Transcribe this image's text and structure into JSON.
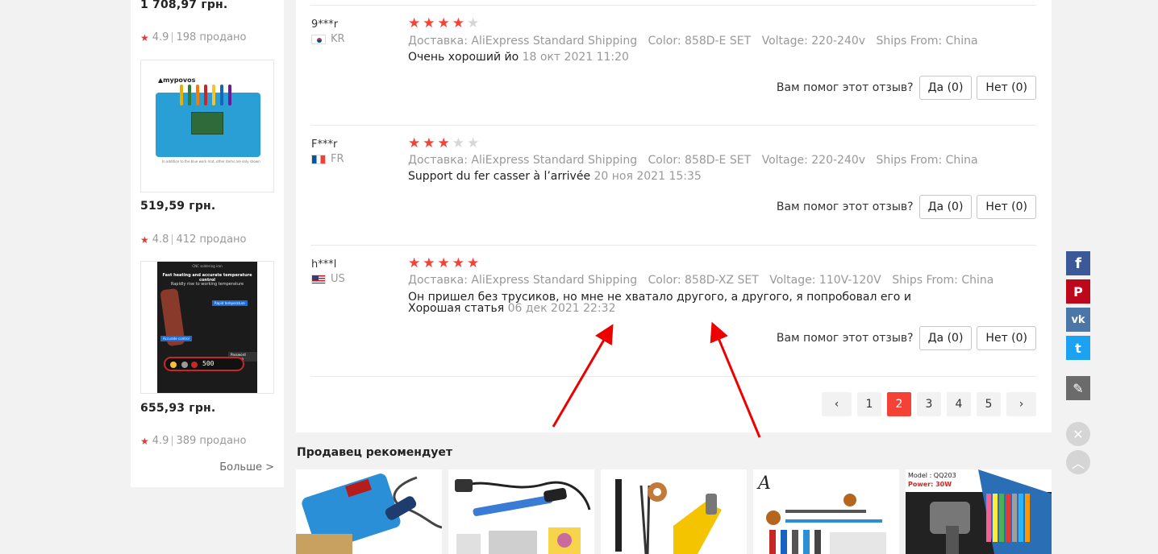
{
  "sidebar": {
    "items": [
      {
        "price": "1 708,97 грн.",
        "rating": "4.9",
        "sold": "198 продано"
      },
      {
        "price": "519,59 грн.",
        "rating": "4.8",
        "sold": "412 продано",
        "logo_text": "mypovos",
        "caption": "In addition to the blue work mat, other items are only shown"
      },
      {
        "price": "655,93 грн.",
        "rating": "4.9",
        "sold": "389 продано",
        "img_title": "CNC soldering iron",
        "img_headline": "Fast heating and accurate temperature control",
        "img_sub": "Rapidly rise to working temperature",
        "img_tag1": "Rapid temperature",
        "img_tag2": "Accurate control",
        "img_digits": "500",
        "img_tag3": "Password function"
      }
    ],
    "more_label": "Больше >"
  },
  "reviews": [
    {
      "user": "9***r",
      "country": "KR",
      "stars": 4,
      "shipping": "Доставка: AliExpress Standard Shipping",
      "color": "Color: 858D-E SET",
      "voltage": "Voltage: 220-240v",
      "ships_from": "Ships From: China",
      "text": "Очень хороший йо",
      "date": "18 окт 2021 11:20"
    },
    {
      "user": "F***r",
      "country": "FR",
      "stars": 3,
      "shipping": "Доставка: AliExpress Standard Shipping",
      "color": "Color: 858D-E SET",
      "voltage": "Voltage: 220-240v",
      "ships_from": "Ships From: China",
      "text": "Support du fer casser à l’arrivée",
      "date": "20 ноя 2021 15:35"
    },
    {
      "user": "h***l",
      "country": "US",
      "stars": 5,
      "shipping": "Доставка: AliExpress Standard Shipping",
      "color": "Color: 858D-XZ SET",
      "voltage": "Voltage: 110V-120V",
      "ships_from": "Ships From: China",
      "text": "Он пришел без трусиков, но мне не хватало другого, а другого, я попробовал его и Хорошая статья",
      "date": "06 дек 2021 22:32"
    }
  ],
  "helpful": {
    "question": "Вам помог этот отзыв?",
    "yes": "Да (0)",
    "no": "Нет (0)"
  },
  "pagination": {
    "prev": "‹",
    "next": "›",
    "pages": [
      "1",
      "2",
      "3",
      "4",
      "5"
    ],
    "current": "2"
  },
  "recommend": {
    "title": "Продавец рекомендует",
    "card5_label": "Model : QQ203",
    "card5_power": "Power: 30W",
    "card4_logo": "A"
  },
  "social": {
    "facebook": "f",
    "pinterest": "P",
    "vk": "vk",
    "twitter": "t",
    "edit_icon": "✎",
    "close_icon": "✕",
    "up_icon": "︿"
  },
  "colors": {
    "accent": "#f44336",
    "facebook": "#3b5998",
    "pinterest": "#bd081c",
    "vk": "#4a76a8",
    "twitter": "#1da1f2",
    "edit": "#6b6b6b"
  }
}
